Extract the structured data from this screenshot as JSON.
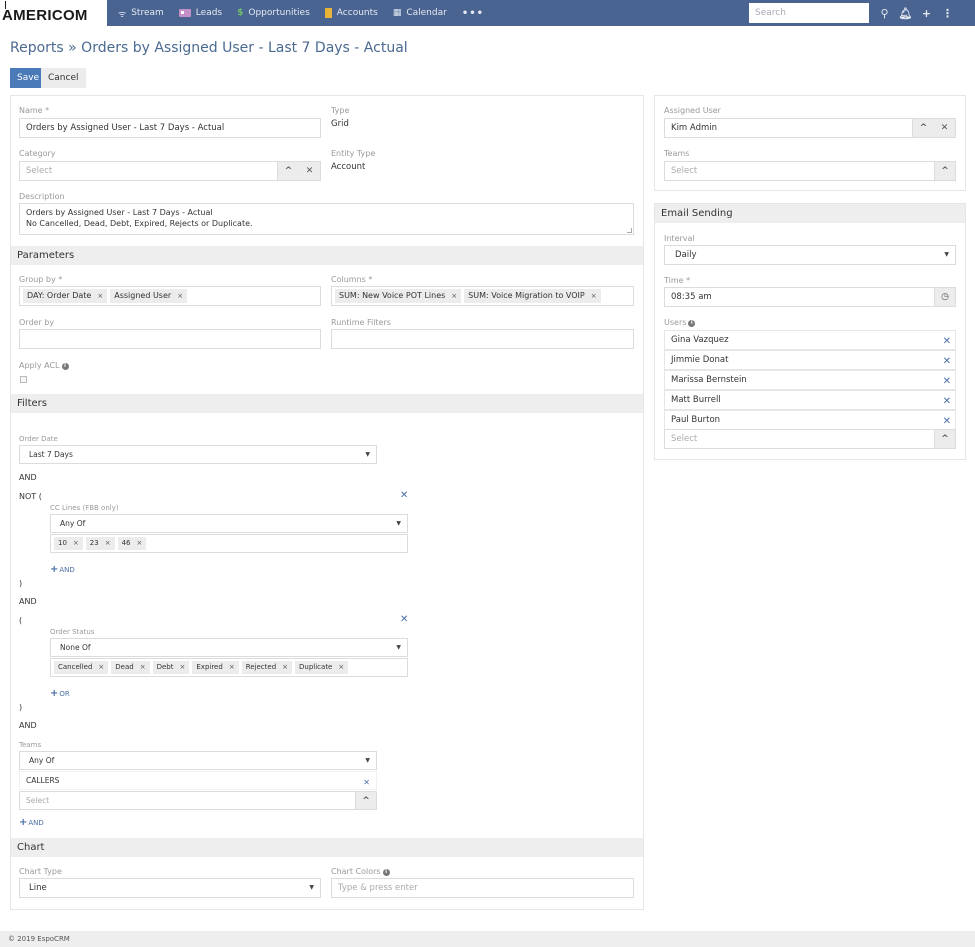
{
  "navbar": {
    "logo": "AMERICOM",
    "items": [
      {
        "label": "Stream",
        "icon": "rss-icon"
      },
      {
        "label": "Leads",
        "icon": "id-card-icon"
      },
      {
        "label": "Opportunities",
        "icon": "dollar-icon"
      },
      {
        "label": "Accounts",
        "icon": "building-icon"
      },
      {
        "label": "Calendar",
        "icon": "calendar-icon"
      }
    ],
    "more": "•••",
    "search_placeholder": "Search"
  },
  "header": {
    "title": "Reports » Orders by Assigned User - Last 7 Days - Actual",
    "save_label": "Save",
    "cancel_label": "Cancel"
  },
  "overview": {
    "name_label": "Name *",
    "name_value": "Orders by Assigned User - Last 7 Days - Actual",
    "type_label": "Type",
    "type_value": "Grid",
    "category_label": "Category",
    "category_placeholder": "Select",
    "entity_type_label": "Entity Type",
    "entity_type_value": "Account",
    "description_label": "Description",
    "description_line1": "Orders by Assigned User - Last 7 Days - Actual",
    "description_line2": "No Cancelled, Dead, Debt, Expired, Rejects or Duplicate."
  },
  "parameters": {
    "heading": "Parameters",
    "group_by_label": "Group by *",
    "group_by": [
      "DAY: Order Date",
      "Assigned User"
    ],
    "columns_label": "Columns *",
    "columns": [
      "SUM: New Voice POT Lines",
      "SUM: Voice Migration to VOIP"
    ],
    "order_by_label": "Order by",
    "runtime_filters_label": "Runtime Filters",
    "apply_acl_label": "Apply ACL",
    "apply_acl_checked": false
  },
  "filters": {
    "heading": "Filters",
    "order_date_label": "Order Date",
    "order_date_value": "Last 7 Days",
    "and1": "AND",
    "not_open": "NOT (",
    "cc_lines_label": "CC Lines (FBB only)",
    "cc_lines_operator": "Any Of",
    "cc_lines_values": [
      "10",
      "23",
      "46"
    ],
    "add_and": "AND",
    "close1": ")",
    "and2": "AND",
    "group_open": "(",
    "order_status_label": "Order Status",
    "order_status_operator": "None Of",
    "order_status_values": [
      "Cancelled",
      "Dead",
      "Debt",
      "Expired",
      "Rejected",
      "Duplicate"
    ],
    "add_or": "OR",
    "close2": ")",
    "and3": "AND",
    "teams_label": "Teams",
    "teams_operator": "Any Of",
    "teams_selected": "CALLERS",
    "teams_placeholder": "Select",
    "add_and_bottom": "AND"
  },
  "chart": {
    "heading": "Chart",
    "chart_type_label": "Chart Type",
    "chart_type_value": "Line",
    "chart_colors_label": "Chart Colors",
    "chart_colors_placeholder": "Type & press enter"
  },
  "side": {
    "assigned_user_label": "Assigned User",
    "assigned_user_value": "Kim Admin",
    "teams_label": "Teams",
    "teams_placeholder": "Select"
  },
  "email_sending": {
    "heading": "Email Sending",
    "interval_label": "Interval",
    "interval_value": "Daily",
    "time_label": "Time *",
    "time_value": "08:35 am",
    "users_label": "Users",
    "users": [
      "Gina Vazquez",
      "Jimmie Donat",
      "Marissa Bernstein",
      "Matt Burrell",
      "Paul Burton"
    ],
    "users_placeholder": "Select"
  },
  "footer": {
    "text": "© 2019 EspoCRM"
  }
}
